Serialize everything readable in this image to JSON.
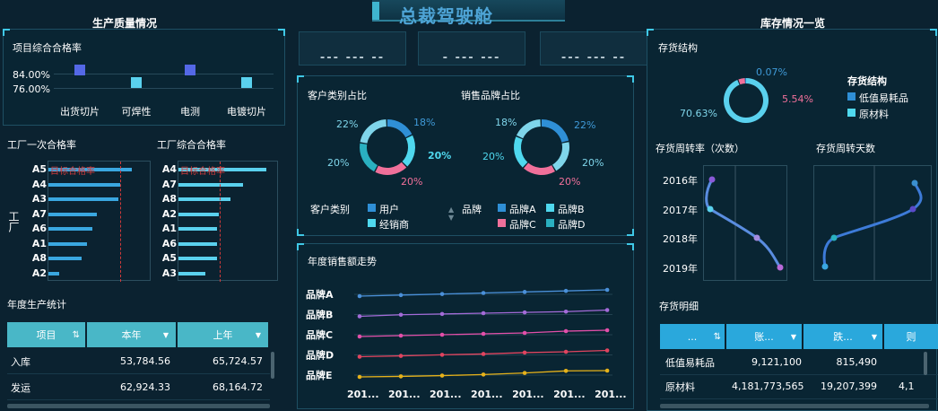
{
  "header": {
    "title": "总裁驾驶舱",
    "kpi": [
      "--- --- --",
      "- --- ---",
      "--- --- --"
    ]
  },
  "left": {
    "title": "生产质量情况",
    "pass_rate": {
      "title": "项目综合合格率",
      "ylabels": [
        "84.00%",
        "76.00%"
      ],
      "items": [
        {
          "label": "出货切片",
          "level": "high",
          "color": "#5468e6"
        },
        {
          "label": "可焊性",
          "level": "low",
          "color": "#5ad1ee"
        },
        {
          "label": "电测",
          "level": "high",
          "color": "#5468e6"
        },
        {
          "label": "电镀切片",
          "level": "low",
          "color": "#5ad1ee"
        }
      ]
    },
    "factory_first": {
      "title": "工厂一次合格率",
      "axis_label": "工厂",
      "target_label": "目标合格率",
      "rows": [
        {
          "name": "A5",
          "value": 0.95
        },
        {
          "name": "A4",
          "value": 0.82
        },
        {
          "name": "A3",
          "value": 0.8
        },
        {
          "name": "A7",
          "value": 0.55
        },
        {
          "name": "A6",
          "value": 0.5
        },
        {
          "name": "A1",
          "value": 0.44
        },
        {
          "name": "A8",
          "value": 0.38
        },
        {
          "name": "A2",
          "value": 0.12
        }
      ]
    },
    "factory_total": {
      "title": "工厂综合合格率",
      "target_label": "目标合格率",
      "rows": [
        {
          "name": "A4",
          "value": 0.98
        },
        {
          "name": "A7",
          "value": 0.72
        },
        {
          "name": "A8",
          "value": 0.58
        },
        {
          "name": "A2",
          "value": 0.45
        },
        {
          "name": "A1",
          "value": 0.43
        },
        {
          "name": "A6",
          "value": 0.43
        },
        {
          "name": "A5",
          "value": 0.43
        },
        {
          "name": "A3",
          "value": 0.3
        }
      ]
    },
    "annual": {
      "title": "年度生产统计",
      "columns": [
        "项目",
        "本年",
        "上年"
      ],
      "rows": [
        [
          "入库",
          "53,784.56",
          "65,724.57"
        ],
        [
          "发运",
          "62,924.33",
          "68,164.72"
        ]
      ]
    }
  },
  "middle": {
    "customer_title": "客户类别占比",
    "brand_title": "销售品牌占比",
    "customer_legend_title": "客户类别",
    "customer_legend": [
      {
        "name": "用户",
        "color": "#2f8fd6"
      },
      {
        "name": "经销商",
        "color": "#4fd8ee"
      }
    ],
    "brand_legend_title": "品牌",
    "brand_legend": [
      {
        "name": "品牌A",
        "color": "#2f8fd6"
      },
      {
        "name": "品牌B",
        "color": "#4fd8ee"
      },
      {
        "name": "品牌C",
        "color": "#f0709a"
      },
      {
        "name": "品牌D",
        "color": "#2ab0c0"
      }
    ],
    "customer_pie_labels": [
      "22%",
      "18%",
      "20%",
      "20%",
      "20%"
    ],
    "brand_pie_labels": [
      "18%",
      "22%",
      "20%",
      "20%",
      "20%"
    ],
    "trend": {
      "title": "年度销售额走势",
      "series": [
        "品牌A",
        "品牌B",
        "品牌C",
        "品牌D",
        "品牌E"
      ],
      "xlabels": [
        "201...",
        "201...",
        "201...",
        "201...",
        "201...",
        "201...",
        "201..."
      ]
    }
  },
  "right": {
    "title": "库存情况一览",
    "structure": {
      "title": "存货结构",
      "legend_title": "存货结构",
      "legend": [
        {
          "name": "低值易耗品",
          "color": "#2f8fd6"
        },
        {
          "name": "原材料",
          "color": "#4fd8ee"
        }
      ],
      "labels": [
        "0.07%",
        "5.54%",
        "70.63%"
      ]
    },
    "turnover_rate": {
      "title": "存货周转率（次数）",
      "years": [
        "2016年",
        "2017年",
        "2018年",
        "2019年"
      ]
    },
    "turnover_days": {
      "title": "存货周转天数"
    },
    "detail": {
      "title": "存货明细",
      "columns": [
        "...",
        "账...",
        "跌...",
        "则"
      ],
      "rows": [
        [
          "低值易耗品",
          "9,121,100",
          "815,490"
        ],
        [
          "原材料",
          "4,181,773,565",
          "19,207,399",
          "4,1"
        ]
      ]
    }
  },
  "chart_data": [
    {
      "type": "bar",
      "title": "工厂一次合格率",
      "categories": [
        "A5",
        "A4",
        "A3",
        "A7",
        "A6",
        "A1",
        "A8",
        "A2"
      ],
      "values": [
        0.95,
        0.82,
        0.8,
        0.55,
        0.5,
        0.44,
        0.38,
        0.12
      ]
    },
    {
      "type": "bar",
      "title": "工厂综合合格率",
      "categories": [
        "A4",
        "A7",
        "A8",
        "A2",
        "A1",
        "A6",
        "A5",
        "A3"
      ],
      "values": [
        0.98,
        0.72,
        0.58,
        0.45,
        0.43,
        0.43,
        0.43,
        0.3
      ]
    },
    {
      "type": "pie",
      "title": "客户类别占比",
      "labels": [
        "22%",
        "18%",
        "20%",
        "20%",
        "20%"
      ]
    },
    {
      "type": "pie",
      "title": "销售品牌占比",
      "labels": [
        "18%",
        "22%",
        "20%",
        "20%",
        "20%"
      ]
    },
    {
      "type": "line",
      "title": "年度销售额走势",
      "series": [
        {
          "name": "品牌A",
          "values": [
            8,
            9,
            10,
            11,
            12,
            13,
            14
          ]
        },
        {
          "name": "品牌B",
          "values": [
            6,
            7,
            7.5,
            8,
            8.5,
            9,
            10
          ]
        },
        {
          "name": "品牌C",
          "values": [
            4,
            4.5,
            5,
            5.5,
            6,
            7,
            7.5
          ]
        },
        {
          "name": "品牌D",
          "values": [
            2.5,
            2.8,
            3.2,
            3.5,
            4,
            4.3,
            4.8
          ]
        },
        {
          "name": "品牌E",
          "values": [
            0.3,
            0.5,
            0.8,
            1.2,
            1.8,
            2.6,
            2.7
          ]
        }
      ]
    },
    {
      "type": "line",
      "title": "存货周转率（次数）",
      "categories": [
        "2016年",
        "2017年",
        "2018年",
        "2019年"
      ],
      "values": [
        0.1,
        0.05,
        0.55,
        0.9
      ]
    }
  ]
}
